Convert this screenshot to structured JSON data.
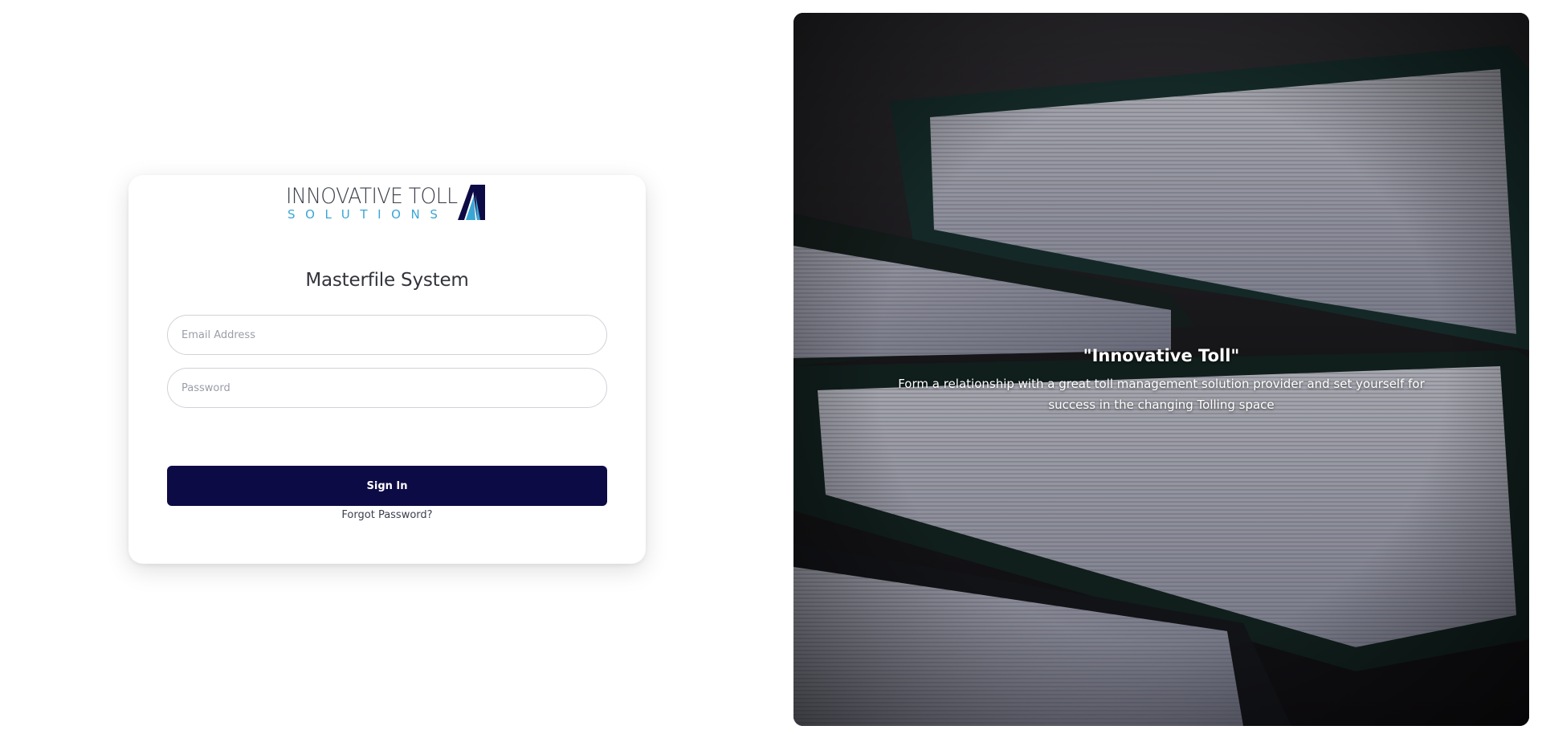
{
  "brand": {
    "name_line1": "INNOVATIVE TOLL",
    "name_line2": "SOLUTIONS",
    "logo_icon": "road-lane-icon",
    "primary_color": "#0d0b45",
    "accent_color": "#3aa6d6"
  },
  "login": {
    "title": "Masterfile System",
    "email_placeholder": "Email Address",
    "password_placeholder": "Password",
    "signin_label": "Sign In",
    "forgot_label": "Forgot Password?"
  },
  "hero": {
    "title": "\"Innovative Toll\"",
    "subtitle": "Form a relationship with a great toll management solution provider and set yourself for success in the changing Tolling space"
  }
}
